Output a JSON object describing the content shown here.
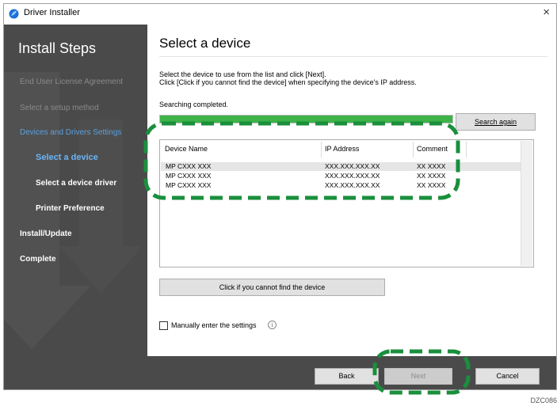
{
  "window": {
    "title": "Driver Installer",
    "close_glyph": "×",
    "icon": "driver-installer-icon"
  },
  "sidebar": {
    "title": "Install Steps",
    "items": [
      {
        "label": "End User License Agreement",
        "state": "done",
        "color": "#8a8a8a"
      },
      {
        "label": "Select a setup method",
        "state": "done",
        "color": "#8a8a8a"
      },
      {
        "label": "Devices and Drivers Settings",
        "state": "active-group",
        "color": "#5aa0e0"
      },
      {
        "label": "Select a device",
        "state": "current",
        "color": "#6ab4f5"
      },
      {
        "label": "Select a device driver",
        "state": "pending",
        "color": "#ffffff"
      },
      {
        "label": "Printer Preference",
        "state": "pending",
        "color": "#ffffff"
      },
      {
        "label": "Install/Update",
        "state": "pending",
        "color": "#ffffff"
      },
      {
        "label": "Complete",
        "state": "pending",
        "color": "#ffffff"
      }
    ]
  },
  "main": {
    "title": "Select a device",
    "instruction_line1": "Select the device to use from the list and click [Next].",
    "instruction_line2": "Click [Click if you cannot find the device] when specifying the device's IP address.",
    "status": "Searching completed.",
    "progress_fraction": 1.0,
    "progress_color": "#3db34a",
    "search_again_label": "Search again",
    "columns": [
      "Device Name",
      "IP Address",
      "Comment"
    ],
    "rows": [
      [
        "MP CXXX XXX",
        "XXX.XXX.XXX.XX",
        "XX XXXX"
      ],
      [
        "MP CXXX XXX",
        "XXX.XXX.XXX.XX",
        "XX XXXX"
      ],
      [
        "MP CXXX XXX",
        "XXX.XXX.XXX.XX",
        "XX XXXX"
      ]
    ],
    "selected_row": 0,
    "cannot_find_label": "Click if you cannot find the device",
    "manual_checkbox_label": "Manually enter the settings",
    "manual_checked": false,
    "info_glyph": "i"
  },
  "footer": {
    "back_label": "Back",
    "next_label": "Next",
    "cancel_label": "Cancel",
    "next_enabled": false
  },
  "highlight_color": "#1a8f3c",
  "figure_code": "DZC086"
}
